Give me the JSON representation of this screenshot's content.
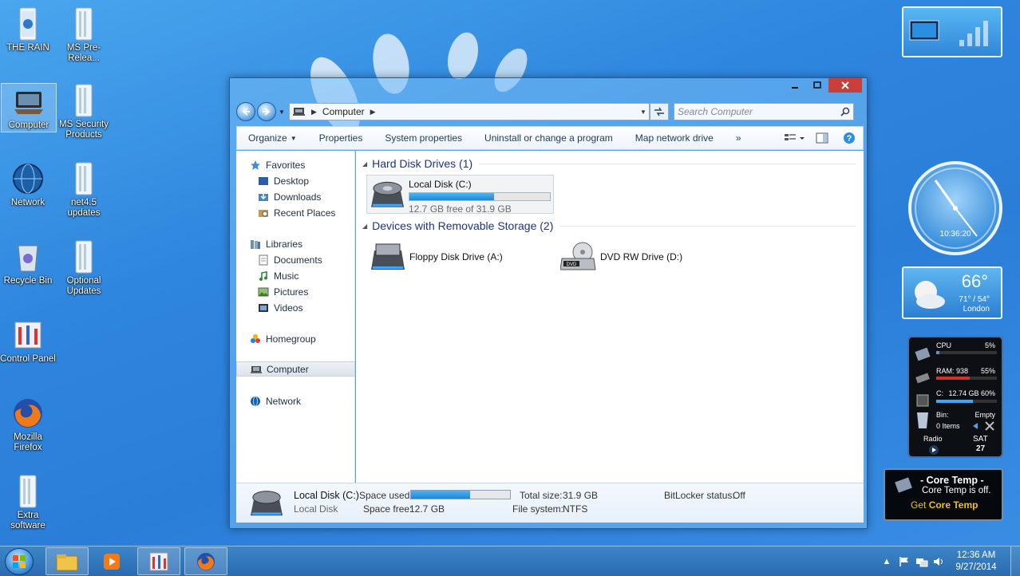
{
  "desktop": {
    "icons": [
      {
        "label": "THE RAIN"
      },
      {
        "label": "MS Pre-Relea..."
      },
      {
        "label": "Computer"
      },
      {
        "label": "MS Security Products"
      },
      {
        "label": "Network"
      },
      {
        "label": "net4.5 updates"
      },
      {
        "label": "Recycle Bin"
      },
      {
        "label": "Optional Updates"
      },
      {
        "label": "Control Panel"
      },
      {
        "label": "Mozilla Firefox"
      },
      {
        "label": "Extra software"
      }
    ]
  },
  "window": {
    "address": {
      "crumb": "Computer"
    },
    "search": {
      "placeholder": "Search Computer"
    },
    "toolbar": {
      "organize": "Organize",
      "properties": "Properties",
      "system_properties": "System properties",
      "uninstall": "Uninstall or change a program",
      "map_drive": "Map network drive",
      "more": "»"
    },
    "nav": {
      "favorites": "Favorites",
      "desktop": "Desktop",
      "downloads": "Downloads",
      "recent": "Recent Places",
      "libraries": "Libraries",
      "documents": "Documents",
      "music": "Music",
      "pictures": "Pictures",
      "videos": "Videos",
      "homegroup": "Homegroup",
      "computer": "Computer",
      "network": "Network"
    },
    "content": {
      "hdd_header": "Hard Disk Drives (1)",
      "removable_header": "Devices with Removable Storage (2)",
      "local_disk": {
        "name": "Local Disk (C:)",
        "free_text": "12.7 GB free of 31.9 GB",
        "used_fraction": 0.6
      },
      "floppy": {
        "name": "Floppy Disk Drive (A:)"
      },
      "dvd": {
        "name": "DVD RW Drive (D:)",
        "badge": "DVD"
      }
    },
    "details": {
      "name": "Local Disk (C:)",
      "type": "Local Disk",
      "space_used_label": "Space used:",
      "space_used_fraction": 0.6,
      "space_free_label": "Space free:",
      "space_free": "12.7 GB",
      "total_size_label": "Total size:",
      "total_size": "31.9 GB",
      "file_system_label": "File system:",
      "file_system": "NTFS",
      "bitlocker_label": "BitLocker status:",
      "bitlocker": "Off"
    }
  },
  "gadgets": {
    "clock_time": "10:36:20",
    "weather": {
      "temp": "66°",
      "range": "71° / 54°",
      "city": "London"
    },
    "meter": {
      "cpu_label": "CPU",
      "cpu_value": "5%",
      "cpu_fraction": 0.05,
      "ram_label": "RAM: 938",
      "ram_value": "55%",
      "ram_fraction": 0.55,
      "disk_label": "C:",
      "disk_value": "12.74 GB 60%",
      "disk_fraction": 0.6,
      "bin_label": "Bin:",
      "bin_items": "0 Items",
      "bin_state": "Empty",
      "radio": "Radio",
      "day": "SAT",
      "date": "27"
    },
    "core_temp": {
      "title": "- Core Temp -",
      "status": "Core Temp is off.",
      "get": "Get",
      "get_name": "Core Temp"
    }
  },
  "taskbar": {
    "time": "12:36 AM",
    "date": "9/27/2014"
  },
  "colors": {
    "accent": "#1e88d6",
    "meter_red": "#d0312d",
    "core_yellow": "#f2c200"
  }
}
